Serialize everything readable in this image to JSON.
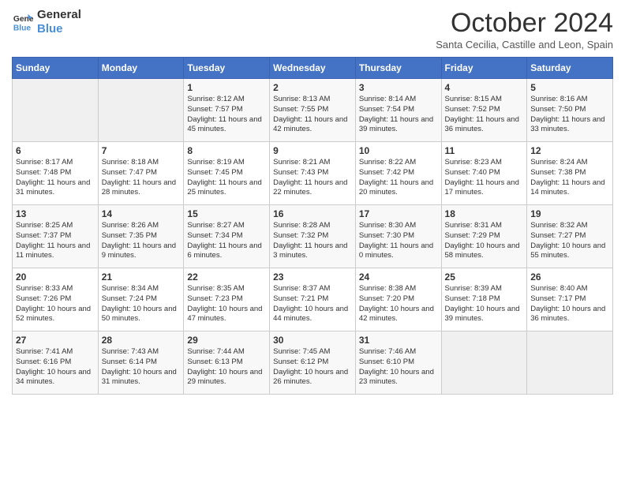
{
  "header": {
    "logo_line1": "General",
    "logo_line2": "Blue",
    "month_title": "October 2024",
    "subtitle": "Santa Cecilia, Castille and Leon, Spain"
  },
  "days_of_week": [
    "Sunday",
    "Monday",
    "Tuesday",
    "Wednesday",
    "Thursday",
    "Friday",
    "Saturday"
  ],
  "weeks": [
    [
      {
        "day": "",
        "info": ""
      },
      {
        "day": "",
        "info": ""
      },
      {
        "day": "1",
        "info": "Sunrise: 8:12 AM\nSunset: 7:57 PM\nDaylight: 11 hours and 45 minutes."
      },
      {
        "day": "2",
        "info": "Sunrise: 8:13 AM\nSunset: 7:55 PM\nDaylight: 11 hours and 42 minutes."
      },
      {
        "day": "3",
        "info": "Sunrise: 8:14 AM\nSunset: 7:54 PM\nDaylight: 11 hours and 39 minutes."
      },
      {
        "day": "4",
        "info": "Sunrise: 8:15 AM\nSunset: 7:52 PM\nDaylight: 11 hours and 36 minutes."
      },
      {
        "day": "5",
        "info": "Sunrise: 8:16 AM\nSunset: 7:50 PM\nDaylight: 11 hours and 33 minutes."
      }
    ],
    [
      {
        "day": "6",
        "info": "Sunrise: 8:17 AM\nSunset: 7:48 PM\nDaylight: 11 hours and 31 minutes."
      },
      {
        "day": "7",
        "info": "Sunrise: 8:18 AM\nSunset: 7:47 PM\nDaylight: 11 hours and 28 minutes."
      },
      {
        "day": "8",
        "info": "Sunrise: 8:19 AM\nSunset: 7:45 PM\nDaylight: 11 hours and 25 minutes."
      },
      {
        "day": "9",
        "info": "Sunrise: 8:21 AM\nSunset: 7:43 PM\nDaylight: 11 hours and 22 minutes."
      },
      {
        "day": "10",
        "info": "Sunrise: 8:22 AM\nSunset: 7:42 PM\nDaylight: 11 hours and 20 minutes."
      },
      {
        "day": "11",
        "info": "Sunrise: 8:23 AM\nSunset: 7:40 PM\nDaylight: 11 hours and 17 minutes."
      },
      {
        "day": "12",
        "info": "Sunrise: 8:24 AM\nSunset: 7:38 PM\nDaylight: 11 hours and 14 minutes."
      }
    ],
    [
      {
        "day": "13",
        "info": "Sunrise: 8:25 AM\nSunset: 7:37 PM\nDaylight: 11 hours and 11 minutes."
      },
      {
        "day": "14",
        "info": "Sunrise: 8:26 AM\nSunset: 7:35 PM\nDaylight: 11 hours and 9 minutes."
      },
      {
        "day": "15",
        "info": "Sunrise: 8:27 AM\nSunset: 7:34 PM\nDaylight: 11 hours and 6 minutes."
      },
      {
        "day": "16",
        "info": "Sunrise: 8:28 AM\nSunset: 7:32 PM\nDaylight: 11 hours and 3 minutes."
      },
      {
        "day": "17",
        "info": "Sunrise: 8:30 AM\nSunset: 7:30 PM\nDaylight: 11 hours and 0 minutes."
      },
      {
        "day": "18",
        "info": "Sunrise: 8:31 AM\nSunset: 7:29 PM\nDaylight: 10 hours and 58 minutes."
      },
      {
        "day": "19",
        "info": "Sunrise: 8:32 AM\nSunset: 7:27 PM\nDaylight: 10 hours and 55 minutes."
      }
    ],
    [
      {
        "day": "20",
        "info": "Sunrise: 8:33 AM\nSunset: 7:26 PM\nDaylight: 10 hours and 52 minutes."
      },
      {
        "day": "21",
        "info": "Sunrise: 8:34 AM\nSunset: 7:24 PM\nDaylight: 10 hours and 50 minutes."
      },
      {
        "day": "22",
        "info": "Sunrise: 8:35 AM\nSunset: 7:23 PM\nDaylight: 10 hours and 47 minutes."
      },
      {
        "day": "23",
        "info": "Sunrise: 8:37 AM\nSunset: 7:21 PM\nDaylight: 10 hours and 44 minutes."
      },
      {
        "day": "24",
        "info": "Sunrise: 8:38 AM\nSunset: 7:20 PM\nDaylight: 10 hours and 42 minutes."
      },
      {
        "day": "25",
        "info": "Sunrise: 8:39 AM\nSunset: 7:18 PM\nDaylight: 10 hours and 39 minutes."
      },
      {
        "day": "26",
        "info": "Sunrise: 8:40 AM\nSunset: 7:17 PM\nDaylight: 10 hours and 36 minutes."
      }
    ],
    [
      {
        "day": "27",
        "info": "Sunrise: 7:41 AM\nSunset: 6:16 PM\nDaylight: 10 hours and 34 minutes."
      },
      {
        "day": "28",
        "info": "Sunrise: 7:43 AM\nSunset: 6:14 PM\nDaylight: 10 hours and 31 minutes."
      },
      {
        "day": "29",
        "info": "Sunrise: 7:44 AM\nSunset: 6:13 PM\nDaylight: 10 hours and 29 minutes."
      },
      {
        "day": "30",
        "info": "Sunrise: 7:45 AM\nSunset: 6:12 PM\nDaylight: 10 hours and 26 minutes."
      },
      {
        "day": "31",
        "info": "Sunrise: 7:46 AM\nSunset: 6:10 PM\nDaylight: 10 hours and 23 minutes."
      },
      {
        "day": "",
        "info": ""
      },
      {
        "day": "",
        "info": ""
      }
    ]
  ]
}
